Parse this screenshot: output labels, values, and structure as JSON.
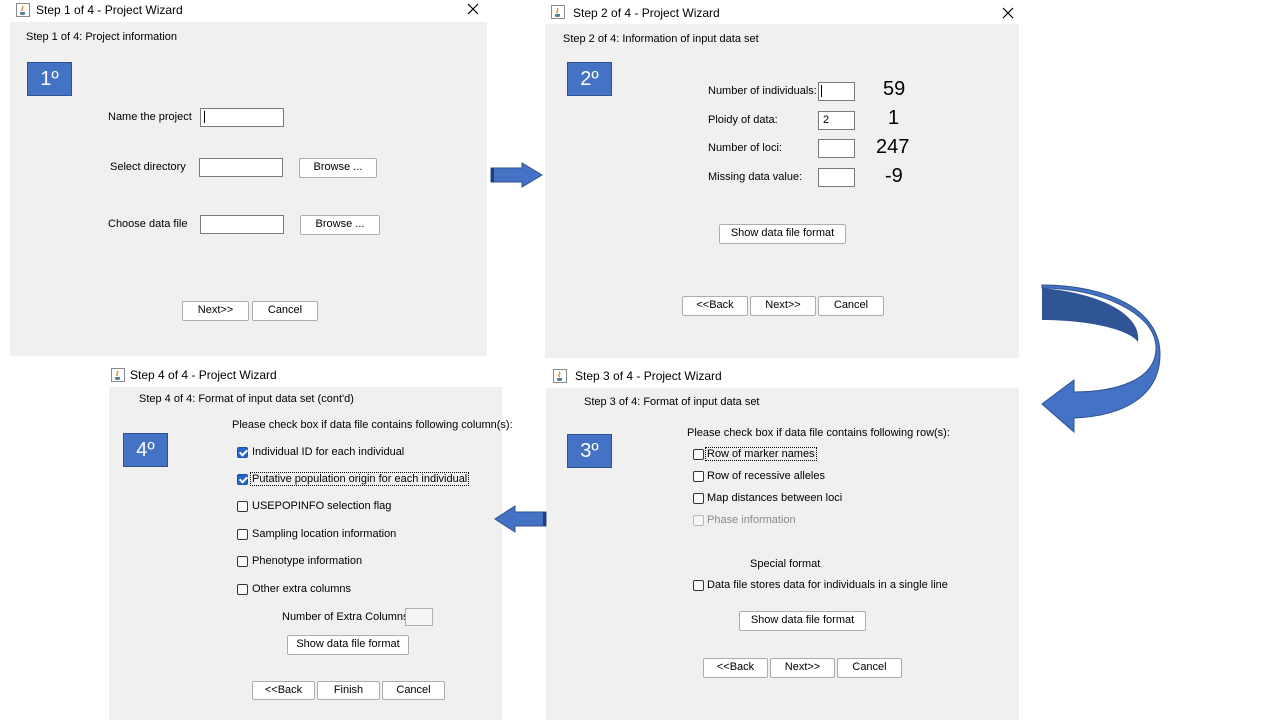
{
  "step1": {
    "title": "Step 1 of 4 - Project Wizard",
    "heading": "Step 1 of 4: Project information",
    "badge": "1º",
    "name_label": "Name the project",
    "name_value": "",
    "directory_label": "Select directory",
    "directory_value": "",
    "datafile_label": "Choose data file",
    "datafile_value": "",
    "browse_label": "Browse ...",
    "next_label": "Next>>",
    "cancel_label": "Cancel"
  },
  "step2": {
    "title": "Step 2 of 4 - Project Wizard",
    "heading": "Step 2 of 4: Information of input data set",
    "badge": "2º",
    "fields": [
      {
        "label": "Number of individuals:",
        "value": "",
        "annotation": "59"
      },
      {
        "label": "Ploidy of data:",
        "value": "2",
        "annotation": "1"
      },
      {
        "label": "Number of loci:",
        "value": "",
        "annotation": "247"
      },
      {
        "label": "Missing data value:",
        "value": "",
        "annotation": "-9"
      }
    ],
    "show_format_label": "Show data file format",
    "back_label": "<<Back",
    "next_label": "Next>>",
    "cancel_label": "Cancel"
  },
  "step3": {
    "title": "Step 3 of 4 - Project Wizard",
    "heading": "Step 3 of 4: Format of input data set",
    "badge": "3º",
    "instruction": "Please check box if data file contains following row(s):",
    "options": [
      {
        "label": "Row of marker names",
        "checked": false
      },
      {
        "label": "Row of recessive alleles",
        "checked": false
      },
      {
        "label": "Map distances between loci",
        "checked": false
      },
      {
        "label": "Phase information",
        "checked": false
      }
    ],
    "special_heading": "Special format",
    "special_option": "Data file stores data for individuals in a single line",
    "show_format_label": "Show data file format",
    "back_label": "<<Back",
    "next_label": "Next>>",
    "cancel_label": "Cancel"
  },
  "step4": {
    "title": "Step 4 of 4 - Project Wizard",
    "heading": "Step 4 of 4: Format of input data set (cont'd)",
    "badge": "4º",
    "instruction": "Please check box if data file contains following column(s):",
    "options": [
      {
        "label": "Individual ID for each individual",
        "checked": true
      },
      {
        "label": "Putative population origin for each individual",
        "checked": true
      },
      {
        "label": "USEPOPINFO selection flag",
        "checked": false
      },
      {
        "label": "Sampling location information",
        "checked": false
      },
      {
        "label": "Phenotype information",
        "checked": false
      },
      {
        "label": "Other extra columns",
        "checked": false
      }
    ],
    "extra_columns_label": "Number of Extra Columns:",
    "extra_columns_value": "",
    "show_format_label": "Show data file format",
    "back_label": "<<Back",
    "finish_label": "Finish",
    "cancel_label": "Cancel"
  },
  "colors": {
    "badge_fill": "#4472c4",
    "arrow_fill": "#4472c4",
    "panel_bg": "#f0f0f0",
    "checkbox_checked": "#2266cc"
  },
  "icons": {
    "title_icon": "java-coffee-cup-icon",
    "close": "close-icon",
    "flow_arrow": "arrow-icon"
  }
}
